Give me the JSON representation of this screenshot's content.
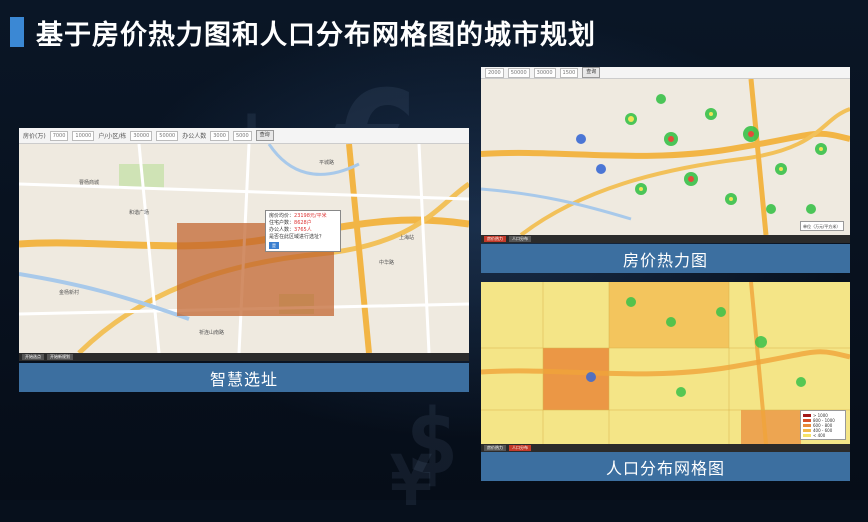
{
  "slide": {
    "title": "基于房价热力图和人口分布网格图的城市规划",
    "accent": "#3b88d4"
  },
  "panel_left": {
    "caption": "智慧选址",
    "toolbar": {
      "field1_label": "房价(万)",
      "field1_min": "7000",
      "field1_max": "10000",
      "field2_label": "户/小区/栋",
      "field2_min": "30000",
      "field2_max": "50000",
      "field3_label": "办公人数",
      "field3_min": "3000",
      "field3_max": "5000",
      "query_button": "查询"
    },
    "popup": {
      "line1_label": "房价均价：",
      "line1_value": "23198元/平米",
      "line2_label": "住宅户数：",
      "line2_value": "8628户",
      "line3_label": "办公人数：",
      "line3_value": "3765人",
      "question": "是否在此区域进行选址？",
      "ok_button": "是"
    },
    "footer_tabs": [
      "开始选点",
      "开始新规划"
    ],
    "place_names": [
      "平城路",
      "和谐广场",
      "金杨新村",
      "中华路",
      "祈连山南路",
      "上海站",
      "曹杨商城"
    ]
  },
  "panel_top_right": {
    "caption": "房价热力图",
    "toolbar": {
      "field1": "2000",
      "field2": "50000",
      "field3": "30000",
      "field4": "1500",
      "query_button": "查询"
    },
    "legend_title": "单位（万元/平方米）",
    "footer_tabs": [
      "房价热力",
      "人口分布"
    ]
  },
  "panel_bottom_right": {
    "caption": "人口分布网格图",
    "footer_tabs": [
      "房价热力",
      "人口分布"
    ],
    "legend_items": [
      "> 1000",
      "800 - 1000",
      "600 - 800",
      "400 - 600",
      "< 400"
    ],
    "legend_colors": [
      "#a31a1a",
      "#d8512a",
      "#e98a3a",
      "#f2b84c",
      "#f5e36a"
    ]
  }
}
